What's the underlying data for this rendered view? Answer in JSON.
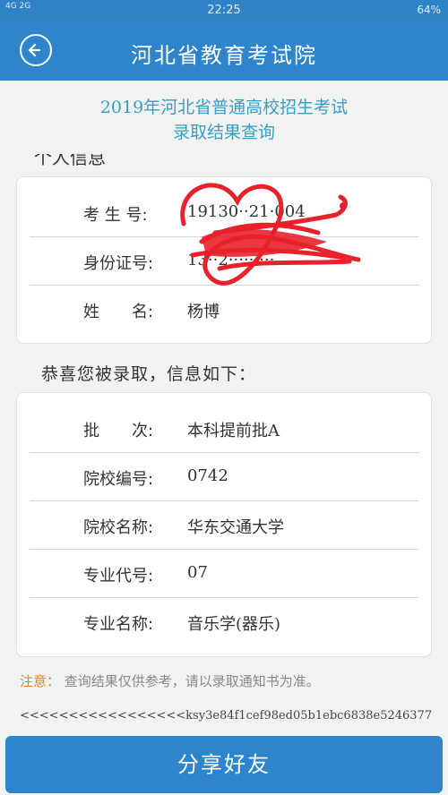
{
  "status_bar": {
    "network": "4G 2G",
    "time": "22:25",
    "battery": "64%"
  },
  "header": {
    "title": "河北省教育考试院",
    "back_icon": "back-arrow-icon"
  },
  "subtitle": {
    "line1": "2019年河北省普通高校招生考试",
    "line2": "录取结果查询"
  },
  "personal": {
    "heading": "个人信息",
    "rows": [
      {
        "label": "考 生 号:",
        "value": "19130··21·004"
      },
      {
        "label": "身份证号:",
        "value": "13··2·········"
      },
      {
        "label": "姓　　名:",
        "value": "杨博"
      }
    ]
  },
  "congrats": "恭喜您被录取，信息如下：",
  "admission": {
    "rows": [
      {
        "label": "批　　次:",
        "value": "本科提前批A"
      },
      {
        "label": "院校编号:",
        "value": "0742"
      },
      {
        "label": "院校名称:",
        "value": "华东交通大学"
      },
      {
        "label": "专业代号:",
        "value": "07"
      },
      {
        "label": "专业名称:",
        "value": "音乐学(器乐)"
      }
    ]
  },
  "notice": {
    "prefix": "注意：",
    "text": "查询结果仅供参考，请以录取通知书为准。"
  },
  "hash": "<<<<<<<<<<<<<<<<<ksy3e84f1cef98ed05b1ebc6838e5246377",
  "share_button": "分享好友",
  "colors": {
    "primary": "#2f85cb",
    "accent_text": "#3a9ec3",
    "notice_prefix": "#d18a2a",
    "scribble": "#e8212b"
  }
}
